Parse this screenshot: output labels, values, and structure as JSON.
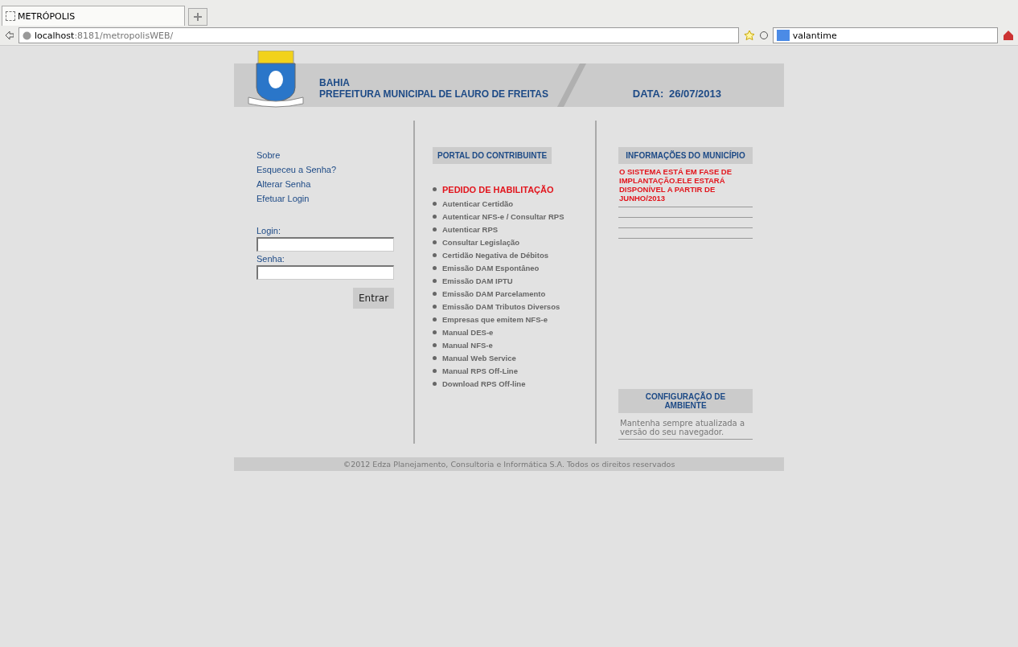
{
  "browser": {
    "tab_title": "METRÓPOLIS",
    "url_host": "localhost",
    "url_rest": ":8181/metropolisWEB/",
    "search_value": "valantime"
  },
  "header": {
    "state": "BAHIA",
    "title": "PREFEITURA MUNICIPAL DE LAURO DE FREITAS",
    "date_label": "DATA:",
    "date": "26/07/2013"
  },
  "sidebar": {
    "links": [
      "Sobre",
      "Esqueceu a Senha?",
      "Alterar Senha",
      "Efetuar Login"
    ],
    "login_label": "Login:",
    "password_label": "Senha:",
    "submit": "Entrar"
  },
  "portal": {
    "title": "PORTAL DO CONTRIBUINTE",
    "items": [
      {
        "label": "PEDIDO DE HABILITAÇÃO",
        "kind": "highlight"
      },
      {
        "label": "Autenticar Certidão",
        "kind": "normal"
      },
      {
        "label": "Autenticar NFS-e / Consultar RPS",
        "kind": "normal"
      },
      {
        "label": "Autenticar RPS",
        "kind": "normal"
      },
      {
        "label": "Consultar Legislação",
        "kind": "normal"
      },
      {
        "label": "Certidão Negativa de Débitos",
        "kind": "normal"
      },
      {
        "label": "Emissão DAM Espontâneo",
        "kind": "normal"
      },
      {
        "label": "Emissão DAM IPTU",
        "kind": "normal"
      },
      {
        "label": "Emissão DAM Parcelamento",
        "kind": "normal"
      },
      {
        "label": "Emissão DAM Tributos Diversos",
        "kind": "normal"
      },
      {
        "label": "Empresas que emitem NFS-e",
        "kind": "normal"
      },
      {
        "label": "Manual DES-e",
        "kind": "normal"
      },
      {
        "label": "Manual NFS-e",
        "kind": "normal"
      },
      {
        "label": "Manual Web Service",
        "kind": "normal"
      },
      {
        "label": "Manual RPS Off-Line",
        "kind": "normal"
      },
      {
        "label": "Download RPS Off-line",
        "kind": "normal"
      }
    ]
  },
  "info": {
    "title": "INFORMAÇÕES DO MUNICÍPIO",
    "notice": "O SISTEMA ESTÁ EM FASE DE IMPLANTAÇÃO.ELE ESTARÁ DISPONÍVEL A PARTIR DE JUNHO/2013",
    "config_title": "CONFIGURAÇÃO DE AMBIENTE",
    "config_text": "Mantenha sempre atualizada a versão do seu navegador."
  },
  "footer": "©2012 Edza Planejamento, Consultoria e Informática S.A. Todos os direitos reservados"
}
